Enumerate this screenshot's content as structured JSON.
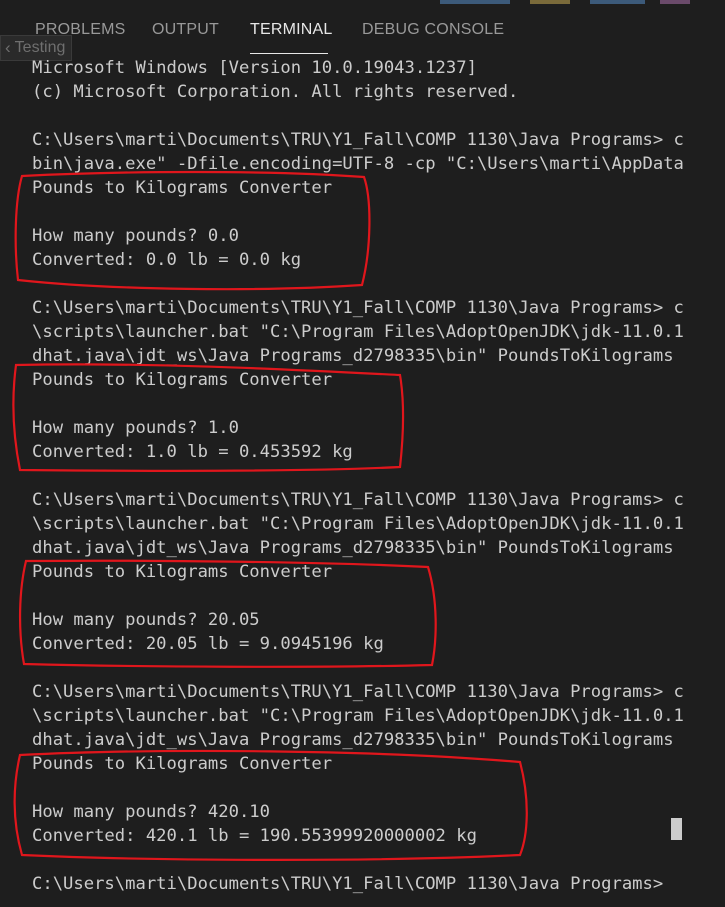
{
  "panel": {
    "tabs": [
      {
        "label": "PROBLEMS"
      },
      {
        "label": "OUTPUT"
      },
      {
        "label": "TERMINAL"
      },
      {
        "label": "DEBUG CONSOLE"
      }
    ],
    "active_tab": "TERMINAL",
    "ghost_label": "Testing"
  },
  "terminal": {
    "lines": [
      "Microsoft Windows [Version 10.0.19043.1237]",
      "(c) Microsoft Corporation. All rights reserved.",
      "",
      "C:\\Users\\marti\\Documents\\TRU\\Y1_Fall\\COMP 1130\\Java Programs> c",
      "bin\\java.exe\" -Dfile.encoding=UTF-8 -cp \"C:\\Users\\marti\\AppData",
      "Pounds to Kilograms Converter",
      "",
      "How many pounds? 0.0",
      "Converted: 0.0 lb = 0.0 kg",
      "",
      "C:\\Users\\marti\\Documents\\TRU\\Y1_Fall\\COMP 1130\\Java Programs> c",
      "\\scripts\\launcher.bat \"C:\\Program Files\\AdoptOpenJDK\\jdk-11.0.1",
      "dhat.java\\jdt_ws\\Java Programs_d2798335\\bin\" PoundsToKilograms",
      "Pounds to Kilograms Converter",
      "",
      "How many pounds? 1.0",
      "Converted: 1.0 lb = 0.453592 kg",
      "",
      "C:\\Users\\marti\\Documents\\TRU\\Y1_Fall\\COMP 1130\\Java Programs> c",
      "\\scripts\\launcher.bat \"C:\\Program Files\\AdoptOpenJDK\\jdk-11.0.1",
      "dhat.java\\jdt_ws\\Java Programs_d2798335\\bin\" PoundsToKilograms",
      "Pounds to Kilograms Converter",
      "",
      "How many pounds? 20.05",
      "Converted: 20.05 lb = 9.0945196 kg",
      "",
      "C:\\Users\\marti\\Documents\\TRU\\Y1_Fall\\COMP 1130\\Java Programs> c",
      "\\scripts\\launcher.bat \"C:\\Program Files\\AdoptOpenJDK\\jdk-11.0.1",
      "dhat.java\\jdt_ws\\Java Programs_d2798335\\bin\" PoundsToKilograms",
      "Pounds to Kilograms Converter",
      "",
      "How many pounds? 420.10",
      "Converted: 420.1 lb = 190.55399920000002 kg",
      "",
      "C:\\Users\\marti\\Documents\\TRU\\Y1_Fall\\COMP 1130\\Java Programs>"
    ]
  },
  "colors": {
    "background": "#1e1e1e",
    "text": "#cccccc",
    "tab_inactive": "#999999",
    "tab_active": "#e7e7e7",
    "annotation": "#e0161c"
  }
}
